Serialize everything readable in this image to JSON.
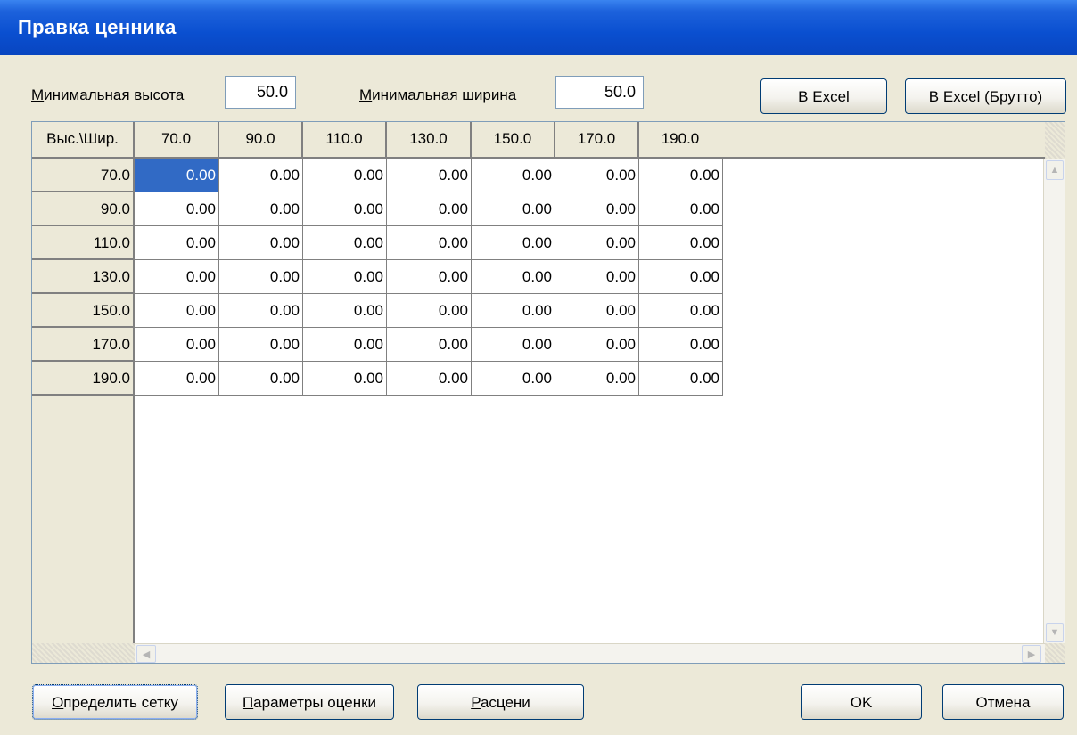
{
  "window": {
    "title": "Правка ценника"
  },
  "params": {
    "min_height_label": "Минимальная высота",
    "min_height_value": "50.0",
    "min_width_label": "Минимальная ширина",
    "min_width_value": "50.0"
  },
  "export": {
    "excel": "В Excel",
    "excel_gross": "В Excel (Брутто)"
  },
  "grid": {
    "corner": "Выс.\\Шир.",
    "columns": [
      "70.0",
      "90.0",
      "110.0",
      "130.0",
      "150.0",
      "170.0",
      "190.0"
    ],
    "rows": [
      {
        "h": "70.0",
        "v": [
          "0.00",
          "0.00",
          "0.00",
          "0.00",
          "0.00",
          "0.00",
          "0.00"
        ]
      },
      {
        "h": "90.0",
        "v": [
          "0.00",
          "0.00",
          "0.00",
          "0.00",
          "0.00",
          "0.00",
          "0.00"
        ]
      },
      {
        "h": "110.0",
        "v": [
          "0.00",
          "0.00",
          "0.00",
          "0.00",
          "0.00",
          "0.00",
          "0.00"
        ]
      },
      {
        "h": "130.0",
        "v": [
          "0.00",
          "0.00",
          "0.00",
          "0.00",
          "0.00",
          "0.00",
          "0.00"
        ]
      },
      {
        "h": "150.0",
        "v": [
          "0.00",
          "0.00",
          "0.00",
          "0.00",
          "0.00",
          "0.00",
          "0.00"
        ]
      },
      {
        "h": "170.0",
        "v": [
          "0.00",
          "0.00",
          "0.00",
          "0.00",
          "0.00",
          "0.00",
          "0.00"
        ]
      },
      {
        "h": "190.0",
        "v": [
          "0.00",
          "0.00",
          "0.00",
          "0.00",
          "0.00",
          "0.00",
          "0.00"
        ]
      }
    ],
    "selected_cell": "row 1, col 1"
  },
  "footer": {
    "define_grid": "Определить сетку",
    "eval_params": "Параметры оценки",
    "price": "Расцени",
    "ok": "OK",
    "cancel": "Отмена"
  },
  "colors": {
    "title_bar": "#0a4fd0",
    "selection": "#316ac5",
    "face": "#ece9d8"
  }
}
